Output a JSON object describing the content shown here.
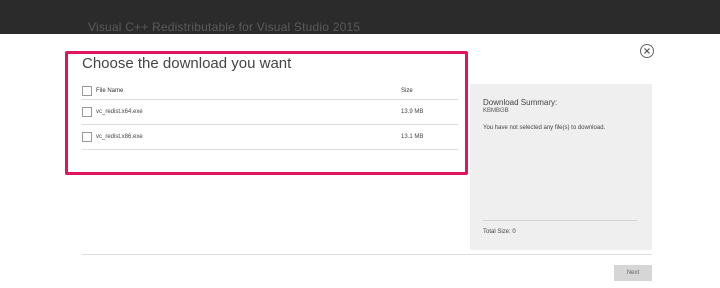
{
  "window": {
    "title": "Visual C++ Redistributable for Visual Studio 2015"
  },
  "dialog": {
    "heading": "Choose the download you want",
    "table": {
      "headers": {
        "file_name": "File Name",
        "size": "Size"
      },
      "rows": [
        {
          "file_name": "vc_redist.x64.exe",
          "size": "13.9 MB",
          "checked": false
        },
        {
          "file_name": "vc_redist.x86.exe",
          "size": "13.1 MB",
          "checked": false
        }
      ]
    },
    "summary": {
      "title": "Download Summary:",
      "code": "KBMBGB",
      "message": "You have not selected any file(s) to download.",
      "total": "Total Size: 0"
    },
    "next_label": "Next"
  },
  "colors": {
    "highlight": "#e0145f",
    "topbar": "#2b2b2b",
    "summary_bg": "#efefef"
  }
}
